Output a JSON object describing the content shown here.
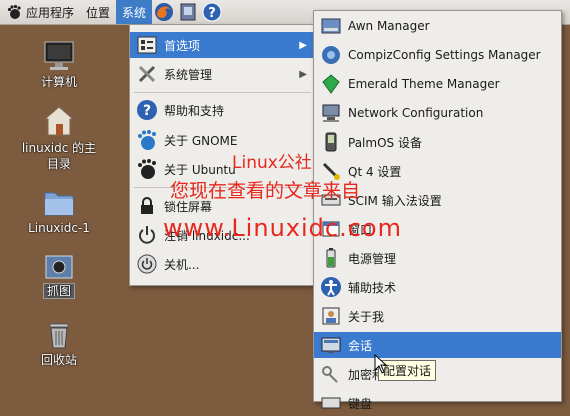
{
  "panel": {
    "menu_apps": "应用程序",
    "menu_places": "位置",
    "menu_system": "系统",
    "launchers": [
      "firefox-icon",
      "text-editor-icon",
      "help-icon"
    ]
  },
  "desktop": {
    "icons": [
      {
        "label": "计算机",
        "icon": "computer-icon"
      },
      {
        "label": "linuxidc 的主目录",
        "icon": "home-folder-icon"
      },
      {
        "label": "Linuxidc-1",
        "icon": "folder-icon"
      },
      {
        "label": "抓图",
        "icon": "screenshot-file-icon",
        "selected": true
      },
      {
        "label": "回收站",
        "icon": "trash-icon"
      }
    ]
  },
  "system_menu": {
    "items": [
      {
        "label": "首选项",
        "icon": "preferences-icon",
        "submenu": true,
        "highlighted": true
      },
      {
        "label": "系统管理",
        "icon": "tools-icon",
        "submenu": true
      },
      {
        "label": "帮助和支持",
        "icon": "help-icon"
      },
      {
        "label": "关于 GNOME",
        "icon": "gnome-icon"
      },
      {
        "label": "关于 Ubuntu",
        "icon": "ubuntu-gnome-icon"
      },
      {
        "label": "锁住屏幕",
        "icon": "lock-icon"
      },
      {
        "label": "注销 linuxidc...",
        "icon": "logout-icon"
      },
      {
        "label": "关机...",
        "icon": "shutdown-icon"
      }
    ]
  },
  "preferences_menu": {
    "items": [
      {
        "label": "Awn Manager",
        "icon": "awn-icon"
      },
      {
        "label": "CompizConfig Settings Manager",
        "icon": "compiz-icon"
      },
      {
        "label": "Emerald Theme Manager",
        "icon": "emerald-icon"
      },
      {
        "label": "Network Configuration",
        "icon": "network-icon"
      },
      {
        "label": "PalmOS 设备",
        "icon": "palm-device-icon"
      },
      {
        "label": "Qt 4 设置",
        "icon": "qt-icon"
      },
      {
        "label": "SCIM 输入法设置",
        "icon": "keyboard-icon"
      },
      {
        "label": "窗口",
        "icon": "window-icon"
      },
      {
        "label": "电源管理",
        "icon": "battery-icon"
      },
      {
        "label": "辅助技术",
        "icon": "accessibility-icon"
      },
      {
        "label": "关于我",
        "icon": "about-me-icon"
      },
      {
        "label": "会话",
        "icon": "session-icon",
        "highlighted": true
      },
      {
        "label": "加密和...",
        "icon": "keys-icon"
      },
      {
        "label": "键盘",
        "icon": "keyboard-icon"
      }
    ]
  },
  "tooltip": "配置对话",
  "watermark": {
    "line1": "Linux公社",
    "line2": "您现在查看的文章来自",
    "line3": "www.Linuxidc.com"
  },
  "colors": {
    "desktop_bg": "#7c5b3f",
    "highlight": "#3a7bd0",
    "watermark": "#e8281e"
  }
}
